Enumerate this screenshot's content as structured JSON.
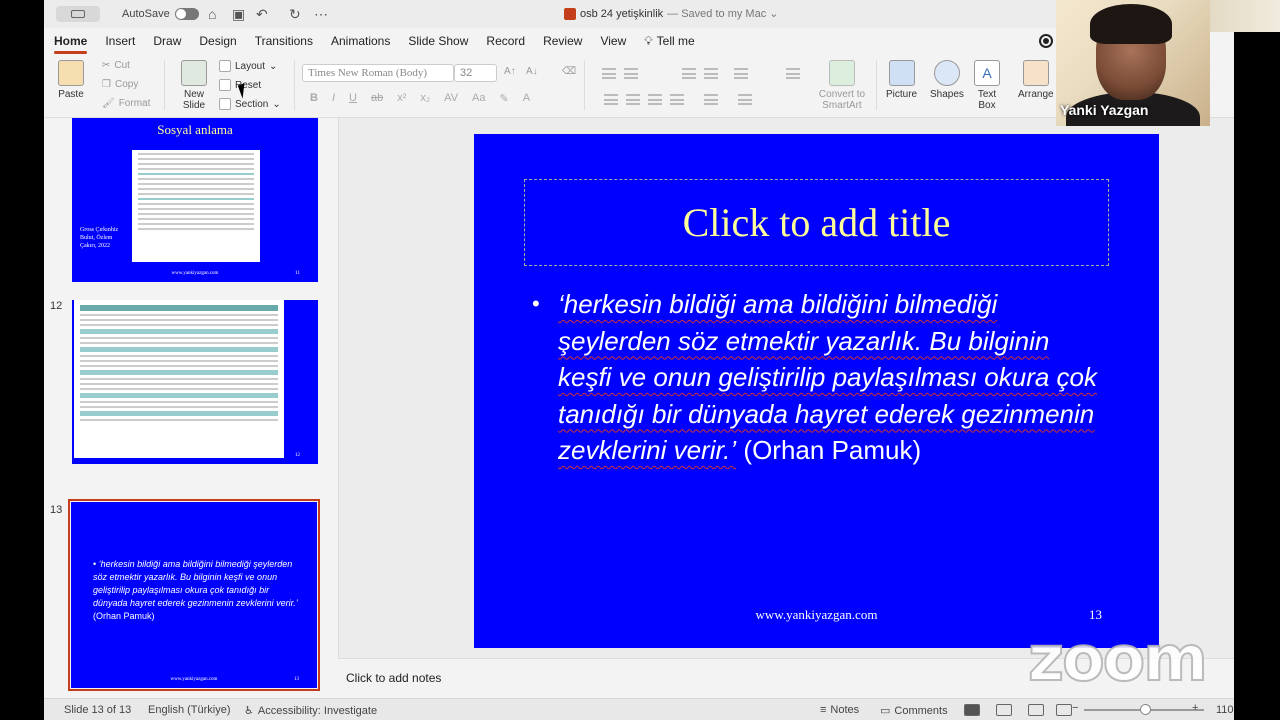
{
  "titlebar": {
    "autosave_label": "AutoSave",
    "doc_title": "osb 24 yetişkinlik",
    "doc_status": "— Saved to my Mac ⌄"
  },
  "tabs": [
    "Home",
    "Insert",
    "Draw",
    "Design",
    "Transitions",
    "Animations",
    "Slide Show",
    "Record",
    "Review",
    "View"
  ],
  "tell_me": "Tell me",
  "ribbon": {
    "paste": "Paste",
    "cut": "Cut",
    "copy": "Copy",
    "format": "Format",
    "new_slide": "New Slide",
    "layout": "Layout",
    "reset": "Reset",
    "section": "Section",
    "font_name": "Times New Roman (Body)",
    "font_size": "32",
    "convert_smartart": "Convert to SmartArt",
    "picture": "Picture",
    "shapes": "Shapes",
    "text_box": "Text Box",
    "arrange": "Arrange"
  },
  "thumbnails": [
    {
      "title": "Sosyal anlama",
      "authors": "Gross Çırkınhiz\nBulut, Özlem\nÇakırı, 2022",
      "footer": "www.yankiyazgan.com",
      "page": "11"
    },
    {
      "number": "12",
      "footer": "www.yankiyazgan.com",
      "page": "12"
    },
    {
      "number": "13",
      "quote": "‘herkesin bildiği ama bildiğini bilmediği şeylerden söz etmektir yazarlık. Bu bilginin keşfi ve onun geliştirilip paylaşılması okura çok tanıdığı bir dünyada hayret ederek gezinmenin zevklerini verir.’",
      "attribution": "(Orhan Pamuk)",
      "footer": "www.yankiyazgan.com",
      "page": "13"
    }
  ],
  "slide": {
    "title_placeholder": "Click to add title",
    "quote": "‘herkesin bildiği ama bildiğini bilmediği şeylerden söz etmektir yazarlık. Bu bilginin keşfi ve onun geliştirilip paylaşılması okura çok tanıdığı bir dünyada hayret ederek gezinmenin zevklerini verir.’",
    "attribution": "(Orhan Pamuk)",
    "footer_url": "www.yankiyazgan.com",
    "page_number": "13"
  },
  "notes_placeholder": "Click to add notes",
  "statusbar": {
    "slide_counter": "Slide 13 of 13",
    "language": "English (Türkiye)",
    "accessibility": "Accessibility: Investigate",
    "notes": "Notes",
    "comments": "Comments",
    "zoom_level": "110"
  },
  "zoom_overlay": {
    "participant_name": "Yanki Yazgan",
    "logo_text": "zoom"
  },
  "colors": {
    "slide_background": "#0000ff",
    "title_color": "#ffff99",
    "accent": "#c43e1c"
  }
}
